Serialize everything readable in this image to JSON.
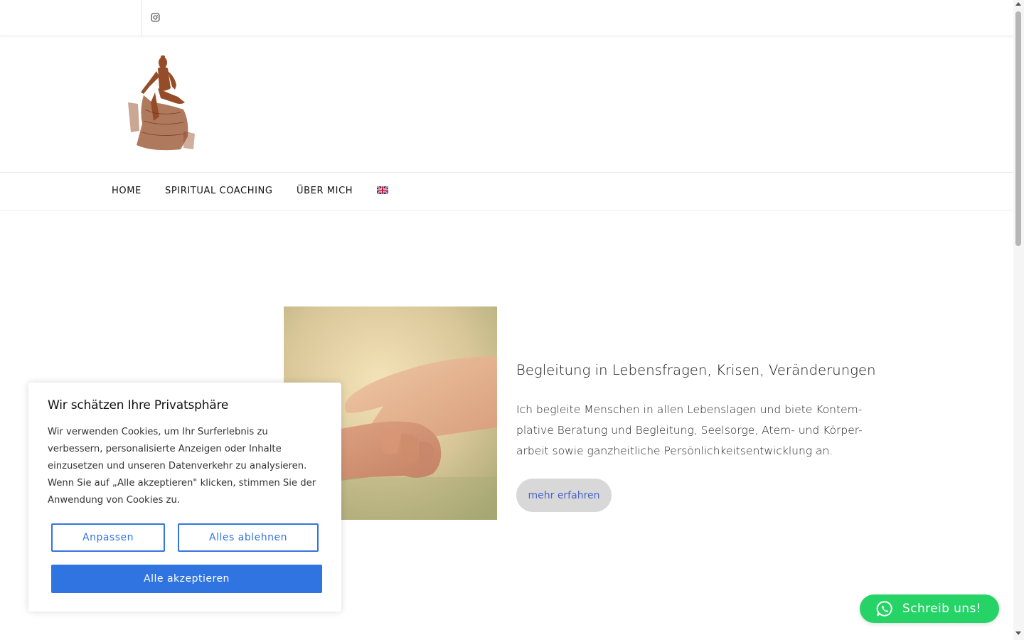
{
  "colors": {
    "accent_blue": "#2f74e0",
    "link_blue": "#4a64c8",
    "whatsapp_green": "#25d366",
    "button_gray": "#d8d8d8"
  },
  "topbar": {
    "social_icon": "instagram-icon"
  },
  "nav": {
    "items": [
      "HOME",
      "SPIRITUAL COACHING",
      "ÜBER MICH"
    ],
    "language_icon": "uk-flag-icon"
  },
  "content": {
    "title": "Begleitung in Lebensfragen, Krisen, Veränderungen",
    "text": "Ich begleite Menschen in allen Lebenslagen und biete Kontem-plative Beratung und Begleitung, Seelsorge, Atem- und Körper-arbeit sowie ganzheitliche Persönlichkeitsentwicklung an.",
    "button_label": "mehr erfahren"
  },
  "cookie": {
    "title": "Wir schätzen Ihre Privatsphäre",
    "text": "Wir verwenden Cookies, um Ihr Surferlebnis zu verbessern, personalisierte Anzeigen oder Inhalte einzusetzen und unseren Datenverkehr zu analysieren. Wenn Sie auf „Alle akzeptieren\" klicken, stimmen Sie der Anwendung von Cookies zu.",
    "customize_label": "Anpassen",
    "reject_label": "Alles ablehnen",
    "accept_label": "Alle akzeptieren"
  },
  "whatsapp": {
    "label": "Schreib uns!",
    "icon": "whatsapp-icon"
  }
}
